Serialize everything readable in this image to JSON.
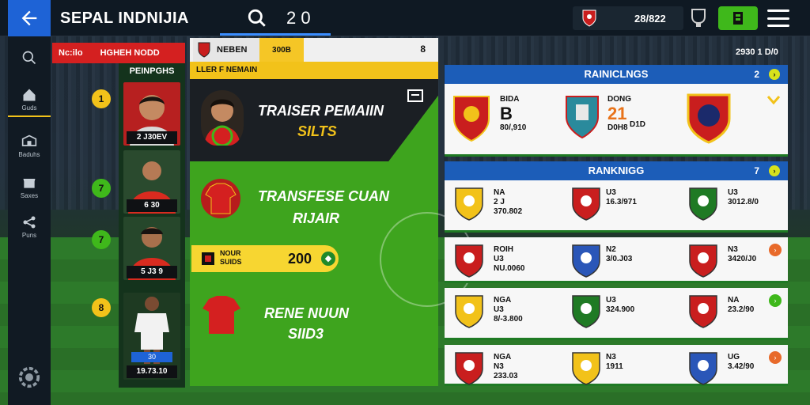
{
  "header": {
    "title": "SEPAL INDNIJIA",
    "count": "2 0",
    "coins": "28/822"
  },
  "sidebar": {
    "items": [
      {
        "label": "",
        "icon": "search-icon"
      },
      {
        "label": "Guds",
        "icon": "home-icon"
      },
      {
        "label": "Baduhs",
        "icon": "stadium-icon"
      },
      {
        "label": "Saxes",
        "icon": "shop-icon"
      },
      {
        "label": "Puns",
        "icon": "network-icon"
      }
    ]
  },
  "squad": {
    "header_a": "Nc:ilo",
    "header_b": "HGHEH NODD",
    "subheader": "PEINPGHS",
    "players": [
      {
        "rank": "1",
        "label": "2 J30EV",
        "badge_color": "#f2c21a"
      },
      {
        "rank": "7",
        "label": "6 30",
        "badge_color": "#3fb81b"
      },
      {
        "rank": "7",
        "label": "5 J3 9",
        "badge_color": "#3fb81b"
      },
      {
        "rank": "8",
        "label": "19.73.10",
        "badge_color": "#f2c21a",
        "tag": "30"
      }
    ]
  },
  "center": {
    "tab_a": "NEBEN",
    "tab_b": "300B",
    "tab_c": "8",
    "banner": "LLER F NEMAIN",
    "feature1_title": "TRAISER PEMAIIN",
    "feature1_sub": "SILTS",
    "feature2_title": "TRANSFESE CUAN",
    "feature2_sub": "RIJAIR",
    "coin_label_1": "NOUR",
    "coin_label_2": "SUIDS",
    "coin_value": "200",
    "feature3_title": "RENE NUUN",
    "feature3_sub": "SIID3"
  },
  "date_label": "2930 1 D/0",
  "rankings_top": {
    "title": "RAINICLNGS",
    "num": "2",
    "teams": [
      {
        "line1": "BIDA",
        "big": "B",
        "line2": "80/,910"
      },
      {
        "line1": "DONG",
        "big": "21",
        "small": "D1D",
        "line2": "D0H8"
      },
      {
        "line1": ""
      }
    ]
  },
  "rankings": {
    "title": "RANKNIGG",
    "num": "7",
    "rows": [
      {
        "c1a": "NA",
        "c1b": "2 J",
        "c1c": "370.802",
        "c2a": "U3",
        "c2b": "16.3/971",
        "c3a": "U3",
        "c3b": "3012.8/0"
      },
      {
        "c1a": "ROIH",
        "c1b": "U3",
        "c1c": "NU.0060",
        "c2a": "N2",
        "c2b": "3/0.J03",
        "c3a": "N3",
        "c3b": "3420/J0"
      },
      {
        "c1a": "NGA",
        "c1b": "U3",
        "c1c": "8/-3.800",
        "c2a": "U3",
        "c2b": "324.900",
        "c3a": "NA",
        "c3b": "23.2/90"
      },
      {
        "c1a": "NGA",
        "c1b": "N3",
        "c1c": "233.03",
        "c2a": "N3",
        "c2b": "1911",
        "c3a": "UG",
        "c3b": "3.42/90"
      }
    ]
  },
  "colors": {
    "accent_blue": "#1e63d6",
    "accent_green": "#3fb81b",
    "accent_yellow": "#f2c21a",
    "accent_red": "#d42020"
  }
}
